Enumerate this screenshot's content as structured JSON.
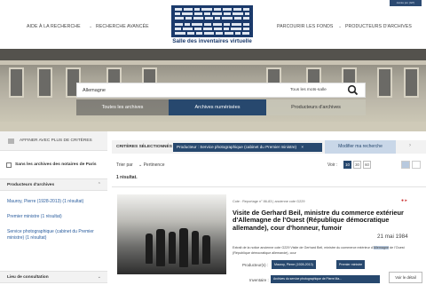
{
  "nav": {
    "left": [
      "AIDE À LA RECHERCHE",
      "RECHERCHE AVANCÉE"
    ],
    "right": [
      "PARCOURIR LES FONDS",
      "PRODUCTEURS D'ARCHIVES"
    ],
    "corner": "Accès pro (GP)"
  },
  "logo": {
    "title": "Salle des inventaires virtuelle"
  },
  "search": {
    "value": "Allemagne",
    "scope": "Tous les mots-salle"
  },
  "search_tabs": [
    "Toutes les archives",
    "Archives numérisées",
    "Producteurs d'archives"
  ],
  "sidebar": {
    "refine": "AFFINER AVEC PLUS DE CRITÈRES",
    "checkbox": "Sans les archives des notaires de Paris",
    "facet1_title": "Producteurs d'archives",
    "facet1_items": [
      "Mauroy, Pierre (1928-2013) (1 résultat)",
      "Premier ministre (1 résultat)",
      "Service photographique (cabinet du Premier ministre) (1 résultat)"
    ],
    "facet2_title": "Lieu de consultation"
  },
  "criteria": {
    "label": "CRITÈRES SÉLECTIONNÉS :",
    "chip": "Producteur : Service photographique (cabinet du Premier ministre)",
    "modify": "Modifier ma recherche"
  },
  "sort": {
    "label": "Trier par",
    "value": "Pertinence"
  },
  "view": {
    "label": "Voir :",
    "options": [
      "10",
      "30",
      "60"
    ],
    "selected": "10"
  },
  "result_count": "1 résultat.",
  "result": {
    "meta": "Cote : Reportage n° 86-83 | ancienne cote G229",
    "title": "Visite de Gerhard Beil, ministre du commerce extérieur d'Allemagne de l'Ouest (République démocratique allemande), cour d'honneur, fumoir",
    "date": "21 mai 1984",
    "extract_pre": "Extrait de la notice ancienne cote G229 Visite de Gerhard Beil, ministre du commerce extérieur d'",
    "extract_hl": "Allemagne",
    "extract_post": " de l'Ouest (République démocratique allemande), cour",
    "producteurs_label": "Producteur(s) :",
    "producteurs": [
      "Mauroy, Pierre (1928-2013)",
      "Premier ministre"
    ],
    "inventaire_label": "Inventaire :",
    "inventaire": "Archives du service photographique de Pierre Ma...",
    "detail": "Voir le détail"
  }
}
